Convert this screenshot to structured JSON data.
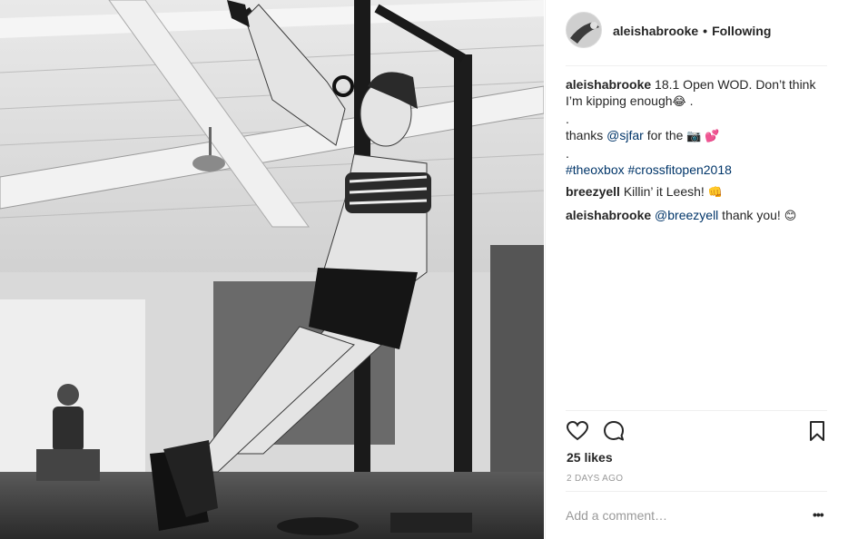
{
  "post": {
    "header": {
      "username": "aleishabrooke",
      "bullet": "•",
      "follow_status": "Following"
    },
    "caption": {
      "username": "aleishabrooke",
      "line1_text": " 18.1 Open WOD. Don’t think I’m kipping enough",
      "line1_emoji": "😂",
      "line1_end": " .",
      "dot1": ".",
      "line2_prefix": "thanks ",
      "line2_mention": "@sjfar",
      "line2_middle": " for the ",
      "line2_emoji1": "📷",
      "line2_emoji2": "💕",
      "dot2": ".",
      "hashtag1": "#theoxbox",
      "hashtag2": "#crossfitopen2018"
    },
    "comments": [
      {
        "username": "breezyell",
        "text": " Killin’ it Leesh! ",
        "emoji": "👊"
      },
      {
        "username": "aleishabrooke",
        "mention": "@breezyell",
        "text": " thank you! ",
        "emoji": "😊"
      }
    ],
    "actions": {
      "like_icon": "heart-icon",
      "comment_icon": "comment-icon",
      "save_icon": "bookmark-icon",
      "likes": "25 likes",
      "timestamp": "2 DAYS AGO"
    },
    "add_comment": {
      "placeholder": "Add a comment…",
      "more": "•••"
    },
    "colors": {
      "link": "#003569",
      "text": "#262626",
      "muted": "#999999",
      "border": "#efefef"
    }
  }
}
